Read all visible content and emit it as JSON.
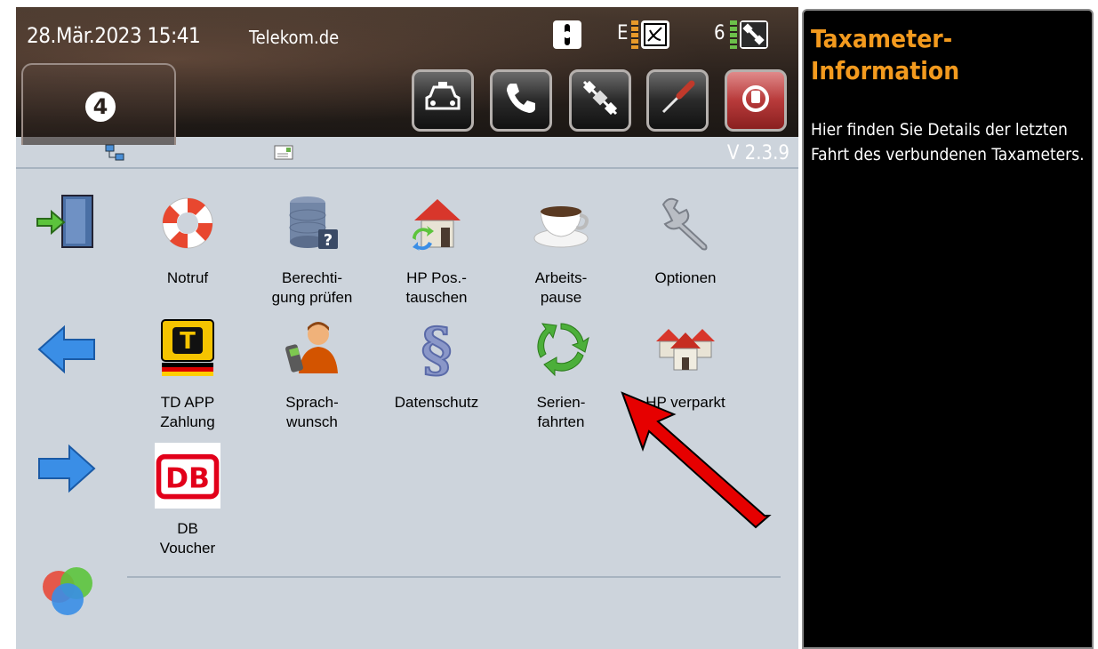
{
  "header": {
    "datetime": "28.Mär.2023 15:41",
    "carrier": "Telekom.de",
    "logo": "4",
    "signal_e_label": "E",
    "signal_6_label": "6",
    "status_icons": [
      "phone-lock-icon",
      "satellite-dish-icon",
      "gps-satellite-icon"
    ],
    "toolbar": [
      {
        "name": "taxi-icon",
        "glyph": "🚕"
      },
      {
        "name": "phone-icon",
        "glyph": "📞"
      },
      {
        "name": "satellite-icon",
        "glyph": "🛰"
      },
      {
        "name": "screwdriver-icon",
        "glyph": "🪛"
      },
      {
        "name": "power-icon",
        "glyph": "⏻"
      }
    ]
  },
  "subbar": {
    "version": "V 2.3.9"
  },
  "menu": {
    "row1": [
      {
        "label": "Notruf",
        "icon": "lifebuoy-icon"
      },
      {
        "label": "Berechti-\ngung prüfen",
        "icon": "database-question-icon"
      },
      {
        "label": "HP Pos.-\ntauschen",
        "icon": "house-swap-icon"
      },
      {
        "label": "Arbeits-\npause",
        "icon": "coffee-cup-icon"
      },
      {
        "label": "Optionen",
        "icon": "wrench-icon"
      }
    ],
    "row2": [
      {
        "label": "TD APP\nZahlung",
        "icon": "td-app-icon"
      },
      {
        "label": "Sprach-\nwunsch",
        "icon": "person-phone-icon"
      },
      {
        "label": "Datenschutz",
        "icon": "paragraph-icon"
      },
      {
        "label": "Serien-\nfahrten",
        "icon": "recycle-arrows-icon"
      },
      {
        "label": "HP verparkt",
        "icon": "houses-icon"
      }
    ],
    "row3": [
      {
        "label": "DB\nVoucher",
        "icon": "db-logo-icon",
        "logo_text": "DB"
      }
    ],
    "td_letter": "T"
  },
  "panel": {
    "title": "Taxameter-\nInformation",
    "body": "Hier finden Sie Details der letzten Fahrt des verbundenen Taxameters."
  },
  "colors": {
    "accent_orange": "#f39a1e",
    "content_bg": "#cdd4dc",
    "annotation_arrow": "#e60000"
  }
}
